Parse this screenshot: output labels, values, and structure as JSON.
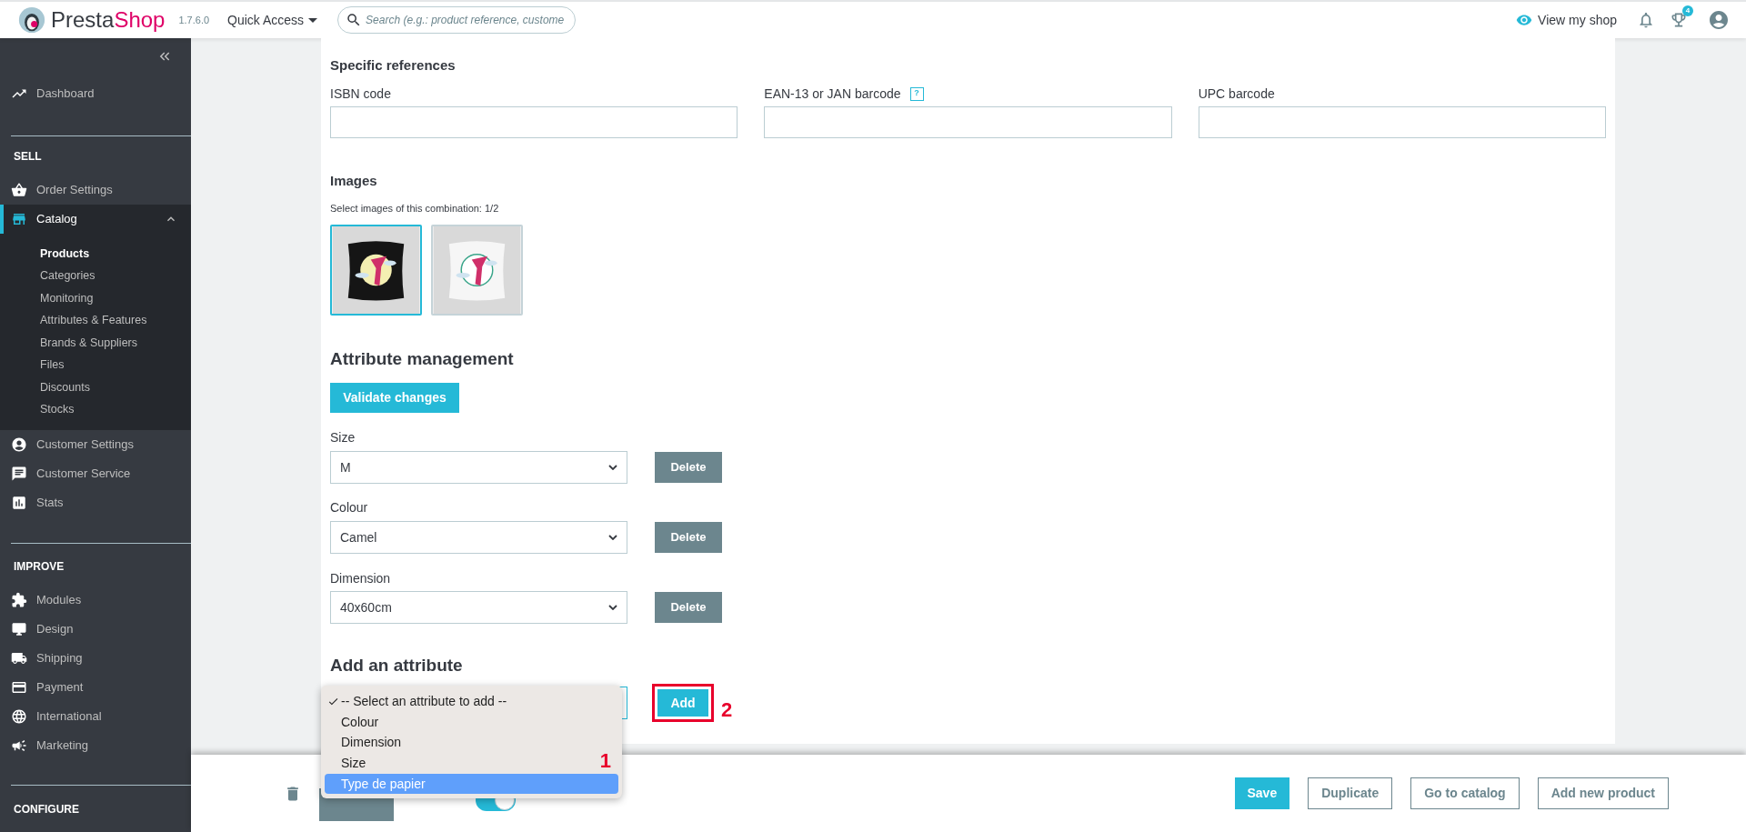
{
  "header": {
    "logo_text_1": "Presta",
    "logo_text_2": "Shop",
    "version": "1.7.6.0",
    "quick_access": "Quick Access",
    "search": {
      "placeholder": "Search (e.g.: product reference, custome"
    },
    "view_shop": "View my shop",
    "trophy_badge": "4"
  },
  "sidebar": {
    "sections": [
      {
        "items": [
          {
            "label": "Dashboard",
            "selected": false
          }
        ]
      },
      {
        "heading": "SELL",
        "items": [
          {
            "label": "Order Settings",
            "selected": false
          },
          {
            "label": "Catalog",
            "selected": true,
            "expanded": true,
            "children": [
              {
                "label": "Products",
                "selected": true
              },
              {
                "label": "Categories",
                "selected": false
              },
              {
                "label": "Monitoring",
                "selected": false
              },
              {
                "label": "Attributes & Features",
                "selected": false
              },
              {
                "label": "Brands & Suppliers",
                "selected": false
              },
              {
                "label": "Files",
                "selected": false
              },
              {
                "label": "Discounts",
                "selected": false
              },
              {
                "label": "Stocks",
                "selected": false
              }
            ]
          },
          {
            "label": "Customer Settings",
            "selected": false
          },
          {
            "label": "Customer Service",
            "selected": false
          },
          {
            "label": "Stats",
            "selected": false
          }
        ]
      },
      {
        "heading": "IMPROVE",
        "items": [
          {
            "label": "Modules",
            "selected": false
          },
          {
            "label": "Design",
            "selected": false
          },
          {
            "label": "Shipping",
            "selected": false
          },
          {
            "label": "Payment",
            "selected": false
          },
          {
            "label": "International",
            "selected": false
          },
          {
            "label": "Marketing",
            "selected": false
          }
        ]
      },
      {
        "heading": "CONFIGURE"
      }
    ]
  },
  "specific_references": {
    "title": "Specific references",
    "fields": [
      {
        "label": "ISBN code"
      },
      {
        "label": "EAN-13 or JAN barcode",
        "help": "?"
      },
      {
        "label": "UPC barcode"
      }
    ]
  },
  "images": {
    "title": "Images",
    "hint": "Select images of this combination: 1/2",
    "thumbnails": [
      {
        "kind": "picture",
        "selected": true
      },
      {
        "kind": "picture",
        "selected": false
      }
    ]
  },
  "attribute_management": {
    "title": "Attribute management",
    "validate_button": "Validate changes",
    "attributes": [
      {
        "label": "Size",
        "value": "M",
        "delete": "Delete"
      },
      {
        "label": "Colour",
        "value": "Camel",
        "delete": "Delete"
      },
      {
        "label": "Dimension",
        "value": "40x60cm",
        "delete": "Delete"
      }
    ]
  },
  "add_attribute": {
    "title": "Add an attribute",
    "dropdown": {
      "annotation": "1",
      "options": [
        {
          "label": "-- Select an attribute to add --",
          "selected": true,
          "highlighted": false
        },
        {
          "label": "Colour",
          "selected": false,
          "highlighted": false
        },
        {
          "label": "Dimension",
          "selected": false,
          "highlighted": false
        },
        {
          "label": "Size",
          "selected": false,
          "highlighted": false
        },
        {
          "label": "Type de papier",
          "selected": false,
          "highlighted": true
        }
      ]
    },
    "add_button": {
      "label": "Add",
      "annotated": true,
      "annotation": "2"
    }
  },
  "footer": {
    "toggle": {
      "on": true
    },
    "buttons": [
      {
        "label": "Save",
        "kind": "primary"
      },
      {
        "label": "Duplicate",
        "kind": "outline"
      },
      {
        "label": "Go to catalog",
        "kind": "outline"
      },
      {
        "label": "Add new product",
        "kind": "outline"
      }
    ]
  }
}
